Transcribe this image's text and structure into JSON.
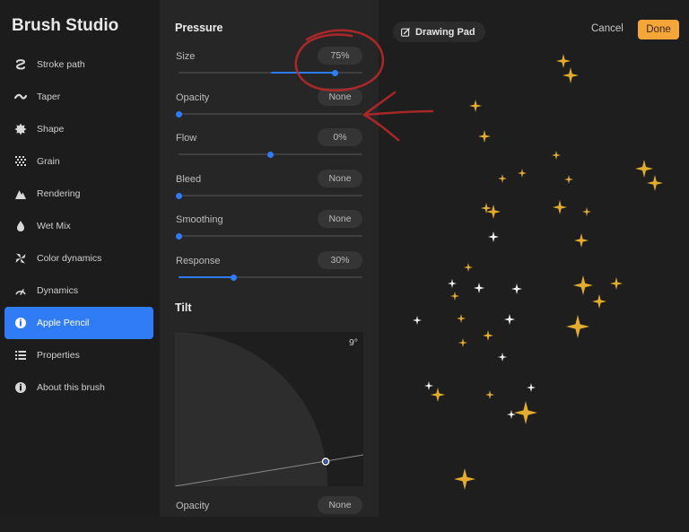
{
  "sidebar": {
    "title": "Brush Studio",
    "items": [
      {
        "label": "Stroke path",
        "icon": "stroke-path-icon"
      },
      {
        "label": "Taper",
        "icon": "taper-icon"
      },
      {
        "label": "Shape",
        "icon": "shape-icon"
      },
      {
        "label": "Grain",
        "icon": "grain-icon"
      },
      {
        "label": "Rendering",
        "icon": "rendering-icon"
      },
      {
        "label": "Wet Mix",
        "icon": "wet-mix-icon"
      },
      {
        "label": "Color dynamics",
        "icon": "color-dynamics-icon"
      },
      {
        "label": "Dynamics",
        "icon": "dynamics-icon"
      },
      {
        "label": "Apple Pencil",
        "icon": "apple-pencil-icon",
        "active": true
      },
      {
        "label": "Properties",
        "icon": "properties-icon"
      },
      {
        "label": "About this brush",
        "icon": "info-icon"
      }
    ]
  },
  "panel": {
    "pressure_title": "Pressure",
    "settings": [
      {
        "label": "Size",
        "value": "75%",
        "slider": 0.85,
        "fill_from": 0.5
      },
      {
        "label": "Opacity",
        "value": "None",
        "slider": 0.0
      },
      {
        "label": "Flow",
        "value": "0%",
        "slider": 0.5
      },
      {
        "label": "Bleed",
        "value": "None",
        "slider": 0.0
      },
      {
        "label": "Smoothing",
        "value": "None",
        "slider": 0.0
      },
      {
        "label": "Response",
        "value": "30%",
        "slider": 0.3,
        "fill_from": 0.0
      }
    ],
    "tilt_title": "Tilt",
    "tilt_value": "9°",
    "tilt_opacity_label": "Opacity",
    "tilt_opacity_value": "None"
  },
  "pad": {
    "drawing_pad_label": "Drawing Pad",
    "cancel_label": "Cancel",
    "done_label": "Done"
  },
  "colors": {
    "accent": "#2f7cf6",
    "done": "#f5a638",
    "sparkle_gold": "#e3ab2f",
    "sparkle_white": "#f2f2f2",
    "annotation": "#c0282a"
  }
}
